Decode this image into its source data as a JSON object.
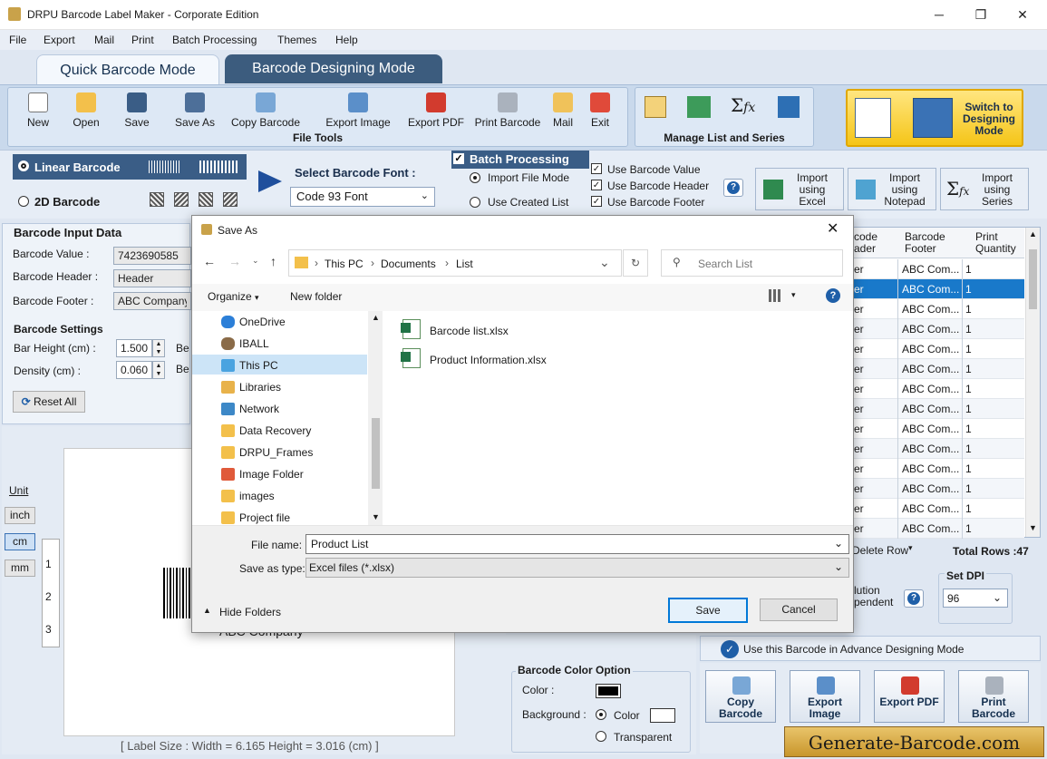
{
  "window": {
    "title": "DRPU Barcode Label Maker - Corporate Edition",
    "min": "─",
    "max": "❐",
    "close": "✕"
  },
  "menu": [
    "File",
    "Export",
    "Mail",
    "Print",
    "Batch Processing",
    "Themes",
    "Help"
  ],
  "modes": {
    "quick": "Quick Barcode Mode",
    "designing": "Barcode Designing Mode"
  },
  "file_tools": {
    "group_label": "File Tools",
    "buttons": [
      "New",
      "Open",
      "Save",
      "Save As",
      "Copy Barcode",
      "Export Image",
      "Export PDF",
      "Print Barcode",
      "Mail",
      "Exit"
    ]
  },
  "manage": {
    "group_label": "Manage List and Series"
  },
  "switch_btn": "Switch to Designing Mode",
  "barcode_type": {
    "linear": "Linear Barcode",
    "twod": "2D Barcode"
  },
  "font": {
    "label": "Select Barcode Font :",
    "value": "Code 93 Font"
  },
  "batch": {
    "title": "Batch Processing",
    "import_file": "Import File Mode",
    "use_created": "Use Created List",
    "use_value": "Use Barcode Value",
    "use_header": "Use Barcode Header",
    "use_footer": "Use Barcode Footer",
    "help": "?"
  },
  "imports": [
    {
      "label": "Import using Excel",
      "icon": "excel-icon"
    },
    {
      "label": "Import using Notepad",
      "icon": "notepad-icon"
    },
    {
      "label": "Import using Series",
      "icon": "series-icon"
    }
  ],
  "input": {
    "section": "Barcode Input Data",
    "value_label": "Barcode Value :",
    "value": "7423690585",
    "header_label": "Barcode Header :",
    "header": "Header",
    "footer_label": "Barcode Footer :",
    "footer": "ABC Company"
  },
  "settings": {
    "section": "Barcode Settings",
    "bar_height_label": "Bar Height (cm) :",
    "bar_height": "1.500",
    "density_label": "Density (cm) :",
    "density": "0.060",
    "be": "Be",
    "reset": "Reset All"
  },
  "units": {
    "label": "Unit",
    "inch": "inch",
    "cm": "cm",
    "mm": "mm"
  },
  "ruler": [
    "1",
    "2",
    "3"
  ],
  "preview_footer": "ABC Company",
  "label_size": "[ Label Size : Width = 6.165  Height = 3.016 (cm) ]",
  "grid": {
    "headers": [
      "code\nader",
      "Barcode\nFooter",
      "Print\nQuantity"
    ],
    "rows": [
      [
        "er",
        "ABC Com...",
        "1"
      ],
      [
        "er",
        "ABC Com...",
        "1"
      ],
      [
        "er",
        "ABC Com...",
        "1"
      ],
      [
        "er",
        "ABC Com...",
        "1"
      ],
      [
        "er",
        "ABC Com...",
        "1"
      ],
      [
        "er",
        "ABC Com...",
        "1"
      ],
      [
        "er",
        "ABC Com...",
        "1"
      ],
      [
        "er",
        "ABC Com...",
        "1"
      ],
      [
        "er",
        "ABC Com...",
        "1"
      ],
      [
        "er",
        "ABC Com...",
        "1"
      ],
      [
        "er",
        "ABC Com...",
        "1"
      ],
      [
        "er",
        "ABC Com...",
        "1"
      ],
      [
        "er",
        "ABC Com...",
        "1"
      ],
      [
        "er",
        "ABC Com...",
        "1"
      ]
    ],
    "selected_row": 1,
    "delete_row": "Delete Row",
    "total_rows": "Total Rows :47"
  },
  "dpi": {
    "label": "Set DPI",
    "value": "96",
    "resolution": "lution\npendent"
  },
  "advance": "Use this Barcode in Advance Designing Mode",
  "color_option": {
    "title": "Barcode Color Option",
    "color_label": "Color :",
    "background_label": "Background :",
    "color_radio": "Color",
    "transparent_radio": "Transparent"
  },
  "bottom_buttons": [
    "Copy Barcode",
    "Export Image",
    "Export PDF",
    "Print Barcode"
  ],
  "watermark": "Generate-Barcode.com",
  "dialog": {
    "title": "Save As",
    "path": [
      "This PC",
      "Documents",
      "List"
    ],
    "search_placeholder": "Search List",
    "organize": "Organize",
    "new_folder": "New folder",
    "nav": [
      "OneDrive",
      "IBALL",
      "This PC",
      "Libraries",
      "Network",
      "Data Recovery",
      "DRPU_Frames",
      "Image Folder",
      "images",
      "Project file"
    ],
    "files": [
      "Barcode list.xlsx",
      "Product Information.xlsx"
    ],
    "file_name_label": "File name:",
    "file_name": "Product List",
    "type_label": "Save as type:",
    "type_value": "Excel files (*.xlsx)",
    "hide_folders": "Hide Folders",
    "save": "Save",
    "cancel": "Cancel"
  },
  "colors": {
    "accent": "#3a5d86",
    "selected": "#1979ca",
    "gold": "#f5c518"
  }
}
